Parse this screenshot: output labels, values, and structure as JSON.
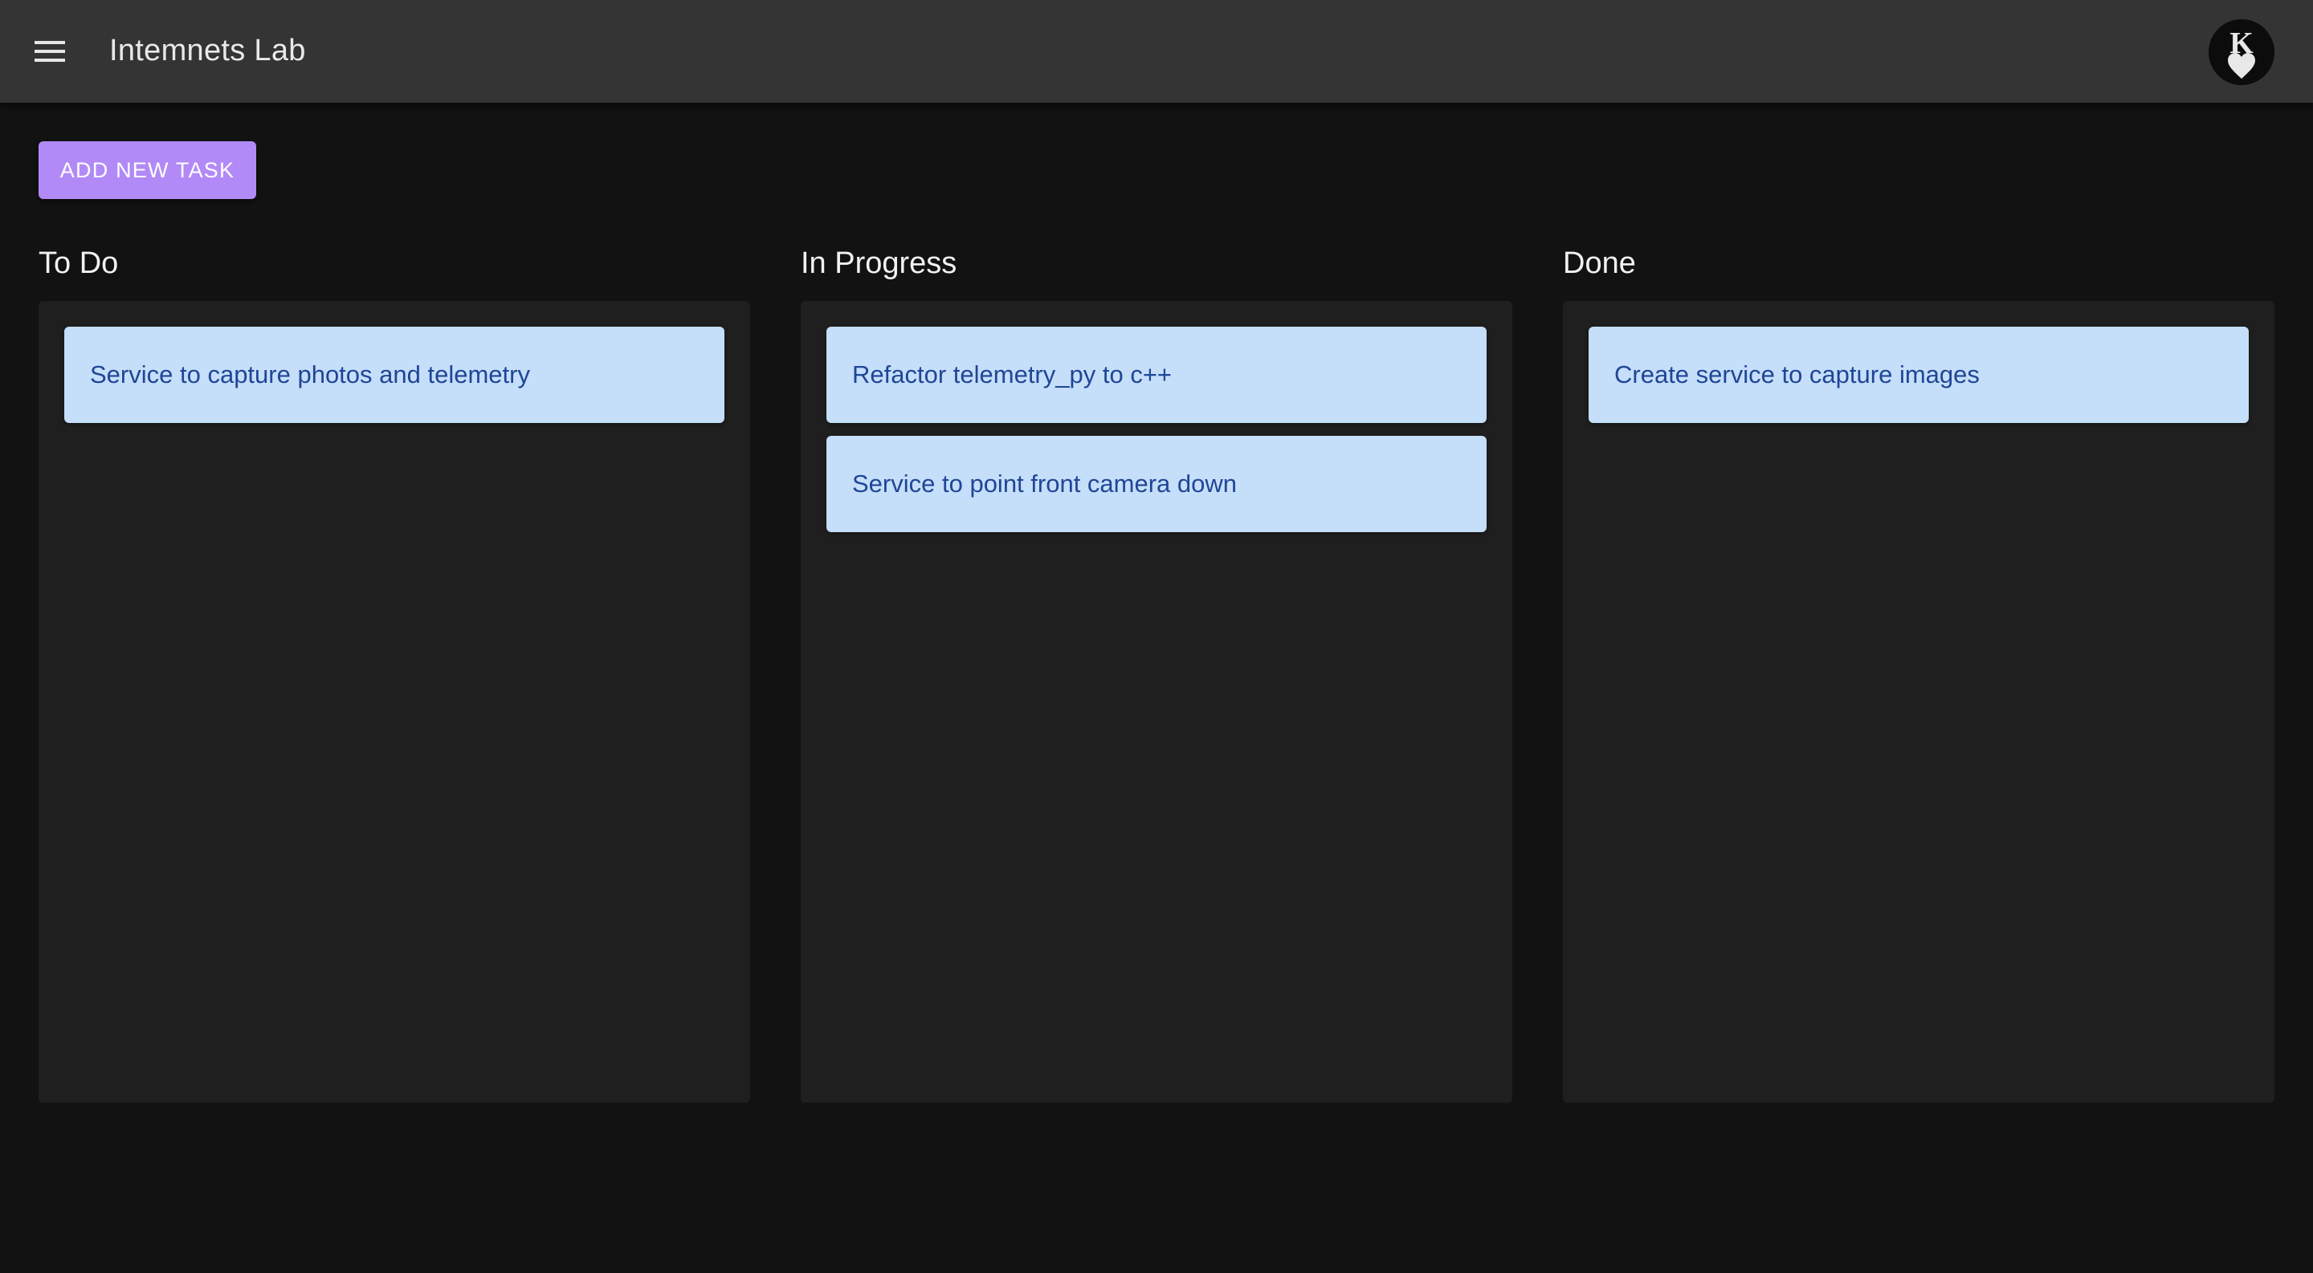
{
  "header": {
    "menu_icon": "hamburger-menu-icon",
    "title": "Intemnets Lab",
    "avatar": {
      "icon": "king-of-hearts-avatar",
      "letter": "K"
    }
  },
  "toolbar": {
    "add_task_label": "ADD NEW TASK"
  },
  "board": {
    "columns": [
      {
        "title": "To Do",
        "cards": [
          {
            "text": "Service to capture photos and telemetry"
          }
        ]
      },
      {
        "title": "In Progress",
        "cards": [
          {
            "text": "Refactor telemetry_py to c++"
          },
          {
            "text": "Service to point front camera down"
          }
        ]
      },
      {
        "title": "Done",
        "cards": [
          {
            "text": "Create service to capture images"
          }
        ]
      }
    ]
  },
  "colors": {
    "appbar": "#343434",
    "background": "#121212",
    "column": "#1f1f1f",
    "card": "#c5defa",
    "card_text": "#1f4696",
    "accent": "#b18af7"
  }
}
